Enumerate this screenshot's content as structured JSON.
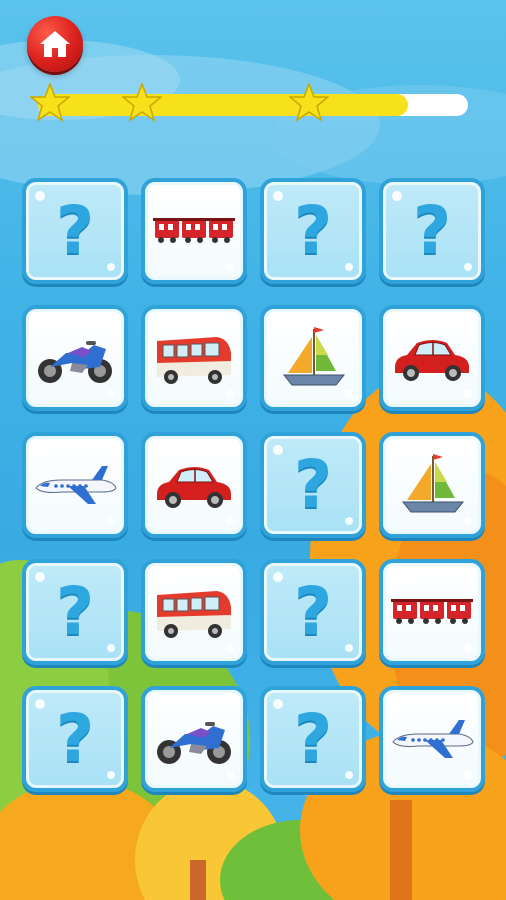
{
  "header": {
    "home_button_icon": "home-icon",
    "progress": 0.86,
    "stars_earned": 3,
    "accent_color": "#d9201c",
    "progress_color": "#f7e11a"
  },
  "board": {
    "rows": 5,
    "columns": 4,
    "hidden_symbol": "?",
    "cards": [
      {
        "state": "hidden",
        "vehicle": null
      },
      {
        "state": "revealed",
        "vehicle": "train"
      },
      {
        "state": "hidden",
        "vehicle": null
      },
      {
        "state": "hidden",
        "vehicle": null
      },
      {
        "state": "revealed",
        "vehicle": "motorcycle"
      },
      {
        "state": "revealed",
        "vehicle": "bus"
      },
      {
        "state": "revealed",
        "vehicle": "sailboat"
      },
      {
        "state": "revealed",
        "vehicle": "car"
      },
      {
        "state": "revealed",
        "vehicle": "airplane"
      },
      {
        "state": "revealed",
        "vehicle": "car"
      },
      {
        "state": "hidden",
        "vehicle": null
      },
      {
        "state": "revealed",
        "vehicle": "sailboat"
      },
      {
        "state": "hidden",
        "vehicle": null
      },
      {
        "state": "revealed",
        "vehicle": "bus"
      },
      {
        "state": "hidden",
        "vehicle": null
      },
      {
        "state": "revealed",
        "vehicle": "train"
      },
      {
        "state": "hidden",
        "vehicle": null
      },
      {
        "state": "revealed",
        "vehicle": "motorcycle"
      },
      {
        "state": "hidden",
        "vehicle": null
      },
      {
        "state": "revealed",
        "vehicle": "airplane"
      }
    ]
  }
}
